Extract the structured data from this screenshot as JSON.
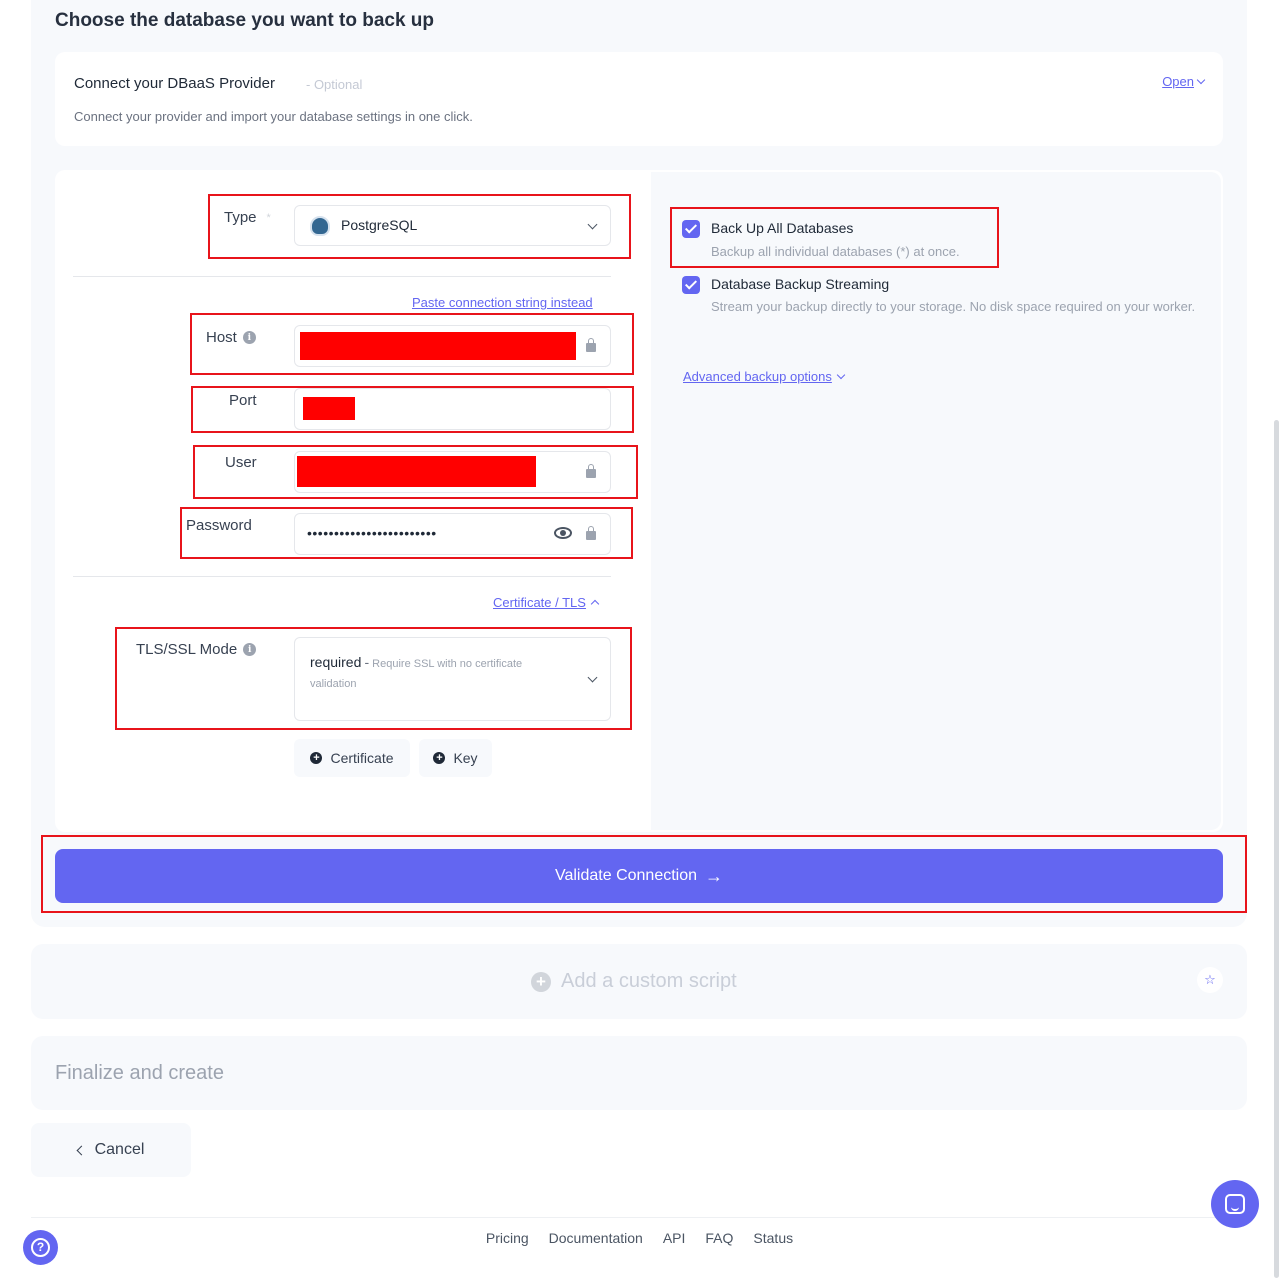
{
  "section": {
    "title": "Choose the database you want to back up"
  },
  "dbaas": {
    "title": "Connect your DBaaS Provider",
    "optional": "- Optional",
    "description": "Connect your provider and import your database settings in one click.",
    "open_label": "Open"
  },
  "form": {
    "type_label": "Type",
    "type_required": "*",
    "type_value": "PostgreSQL",
    "paste_link": "Paste connection string instead",
    "host_label": "Host",
    "port_label": "Port",
    "user_label": "User",
    "password_label": "Password",
    "password_value": "••••••••••••••••••••••••",
    "cert_tls_link": "Certificate / TLS",
    "tls_label": "TLS/SSL Mode",
    "tls_value": "required",
    "tls_separator": "-",
    "tls_desc": "Require SSL with no certificate validation",
    "certificate_btn": "Certificate",
    "key_btn": "Key"
  },
  "options": {
    "backup_all_title": "Back Up All Databases",
    "backup_all_desc": "Backup all individual databases (*) at once.",
    "backup_all_checked": true,
    "streaming_title": "Database Backup Streaming",
    "streaming_desc": "Stream your backup directly to your storage. No disk space required on your worker.",
    "streaming_checked": true,
    "advanced_link": "Advanced backup options"
  },
  "validate_button": "Validate Connection",
  "custom_script": {
    "label": "Add a custom script"
  },
  "finalize": {
    "title": "Finalize and create"
  },
  "cancel_button": "Cancel",
  "footer": {
    "links": [
      "Pricing",
      "Documentation",
      "API",
      "FAQ",
      "Status"
    ]
  },
  "colors": {
    "accent": "#6366f1",
    "highlight": "#e8141b",
    "redaction": "#ff0000"
  }
}
